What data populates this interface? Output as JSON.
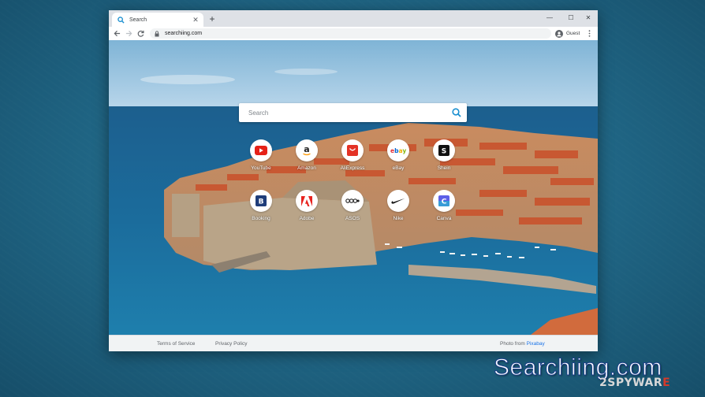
{
  "browser": {
    "tab_title": "Search",
    "new_tab_symbol": "+",
    "tab_close_symbol": "✕",
    "url": "searchiing.com",
    "profile_label": "Guest",
    "window_controls": {
      "minimize": "—",
      "maximize": "☐",
      "close": "✕"
    }
  },
  "search": {
    "placeholder": "Search",
    "icon": "magnifier-icon",
    "accent": "#1a8fd0"
  },
  "shortcuts": [
    {
      "label": "YouTube",
      "icon": "youtube-icon"
    },
    {
      "label": "Amazon",
      "icon": "amazon-icon"
    },
    {
      "label": "AliExpress",
      "icon": "aliexpress-icon"
    },
    {
      "label": "eBay",
      "icon": "ebay-icon"
    },
    {
      "label": "Shein",
      "icon": "shein-icon"
    },
    {
      "label": "Booking",
      "icon": "booking-icon"
    },
    {
      "label": "Adobe",
      "icon": "adobe-icon"
    },
    {
      "label": "ASOS",
      "icon": "asos-icon"
    },
    {
      "label": "Nike",
      "icon": "nike-icon"
    },
    {
      "label": "Canva",
      "icon": "canva-icon"
    }
  ],
  "footer": {
    "terms": "Terms of Service",
    "privacy": "Privacy Policy",
    "photo_prefix": "Photo from",
    "photo_source": "Pixabay"
  },
  "overlay": {
    "caption": "Searchiing.com",
    "logo_part1": "2",
    "logo_part2": "SPYWAR",
    "logo_part3": "E"
  }
}
